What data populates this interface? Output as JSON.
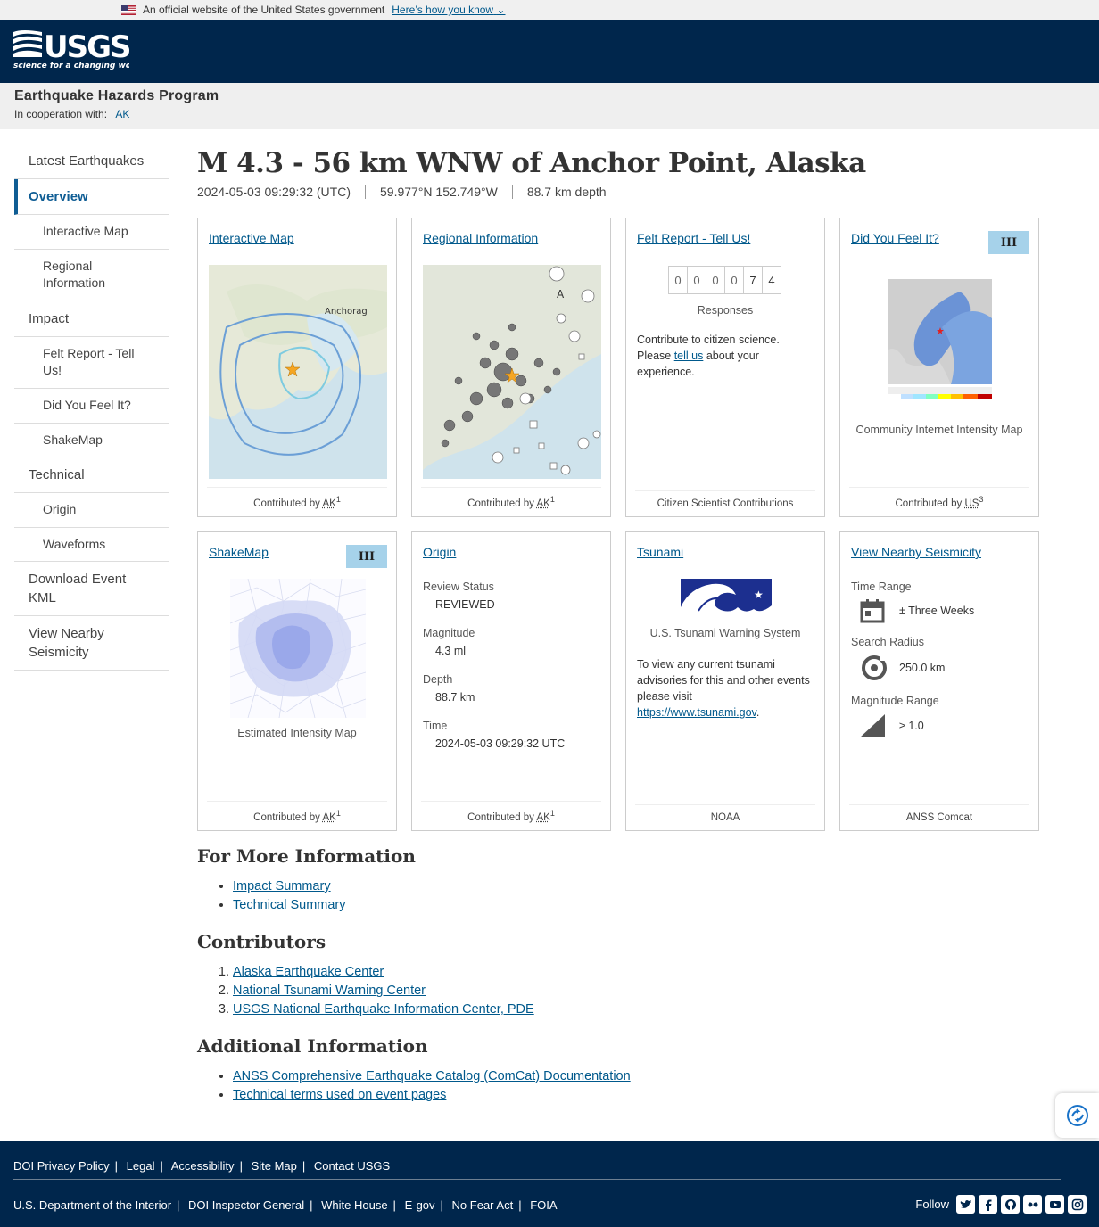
{
  "gov_banner": {
    "text": "An official website of the United States government",
    "link": "Here’s how you know"
  },
  "header": {
    "logo_text": "USGS",
    "logo_tagline": "science for a changing world"
  },
  "program": {
    "title": "Earthquake Hazards Program",
    "coop_label": "In cooperation with:",
    "coop_link": "AK"
  },
  "sidebar": {
    "items": [
      {
        "label": "Latest Earthquakes"
      },
      {
        "label": "Overview"
      },
      {
        "label": "Interactive Map"
      },
      {
        "label": "Regional Information"
      },
      {
        "label": "Impact"
      },
      {
        "label": "Felt Report - Tell Us!"
      },
      {
        "label": "Did You Feel It?"
      },
      {
        "label": "ShakeMap"
      },
      {
        "label": "Technical"
      },
      {
        "label": "Origin"
      },
      {
        "label": "Waveforms"
      },
      {
        "label": "Download Event KML"
      },
      {
        "label": "View Nearby Seismicity"
      }
    ]
  },
  "event": {
    "title": "M 4.3 - 56 km WNW of Anchor Point, Alaska",
    "time": "2024-05-03 09:29:32 (UTC)",
    "location": "59.977°N 152.749°W",
    "depth": "88.7 km depth"
  },
  "cards": {
    "interactive_map": {
      "title": "Interactive Map",
      "map_label": "Anchorag",
      "contrib_prefix": "Contributed by",
      "contrib": "AK",
      "ref": "1"
    },
    "regional": {
      "title": "Regional Information",
      "map_label": "A",
      "contrib_prefix": "Contributed by",
      "contrib": "AK",
      "ref": "1"
    },
    "felt_report": {
      "title": "Felt Report - Tell Us!",
      "digits": [
        "0",
        "0",
        "0",
        "0",
        "7",
        "4"
      ],
      "responses": "Responses",
      "text_before": "Contribute to citizen science. Please ",
      "link": "tell us",
      "text_after": " about your experience.",
      "footer": "Citizen Scientist Contributions"
    },
    "dyfi": {
      "title": "Did You Feel It?",
      "badge": "III",
      "caption": "Community Internet Intensity Map",
      "contrib_prefix": "Contributed by",
      "contrib": "US",
      "ref": "3"
    },
    "shakemap": {
      "title": "ShakeMap",
      "badge": "III",
      "caption": "Estimated Intensity Map",
      "contrib_prefix": "Contributed by",
      "contrib": "AK",
      "ref": "1"
    },
    "origin": {
      "title": "Origin",
      "review_label": "Review Status",
      "review_value": "REVIEWED",
      "mag_label": "Magnitude",
      "mag_value": "4.3 ml",
      "depth_label": "Depth",
      "depth_value": "88.7 km",
      "time_label": "Time",
      "time_value": "2024-05-03 09:29:32 UTC",
      "contrib_prefix": "Contributed by",
      "contrib": "AK",
      "ref": "1"
    },
    "tsunami": {
      "title": "Tsunami",
      "caption": "U.S. Tsunami Warning System",
      "text": "To view any current tsunami advisories for this and other events please visit",
      "link": "https://www.tsunami.gov",
      "footer": "NOAA"
    },
    "seismicity": {
      "title": "View Nearby Seismicity",
      "time_label": "Time Range",
      "time_value": "± Three Weeks",
      "radius_label": "Search Radius",
      "radius_value": "250.0 km",
      "mag_label": "Magnitude Range",
      "mag_value": "≥ 1.0",
      "footer": "ANSS Comcat"
    }
  },
  "more_info": {
    "title": "For More Information",
    "links": [
      "Impact Summary",
      "Technical Summary"
    ]
  },
  "contributors": {
    "title": "Contributors",
    "links": [
      "Alaska Earthquake Center",
      "National Tsunami Warning Center",
      "USGS National Earthquake Information Center, PDE"
    ]
  },
  "additional": {
    "title": "Additional Information",
    "links": [
      "ANSS Comprehensive Earthquake Catalog (ComCat) Documentation",
      "Technical terms used on event pages"
    ]
  },
  "footer": {
    "row1": [
      "DOI Privacy Policy",
      "Legal",
      "Accessibility",
      "Site Map",
      "Contact USGS"
    ],
    "row2": [
      "U.S. Department of the Interior",
      "DOI Inspector General",
      "White House",
      "E-gov",
      "No Fear Act",
      "FOIA"
    ],
    "follow": "Follow",
    "social_icons": [
      "twitter-icon",
      "facebook-icon",
      "github-icon",
      "flickr-icon",
      "youtube-icon",
      "instagram-icon"
    ]
  },
  "colors": {
    "header_bg": "#00264c",
    "link": "#00598c",
    "badge_bg": "#a6d2ea",
    "active_nav": "#0f5d94"
  }
}
